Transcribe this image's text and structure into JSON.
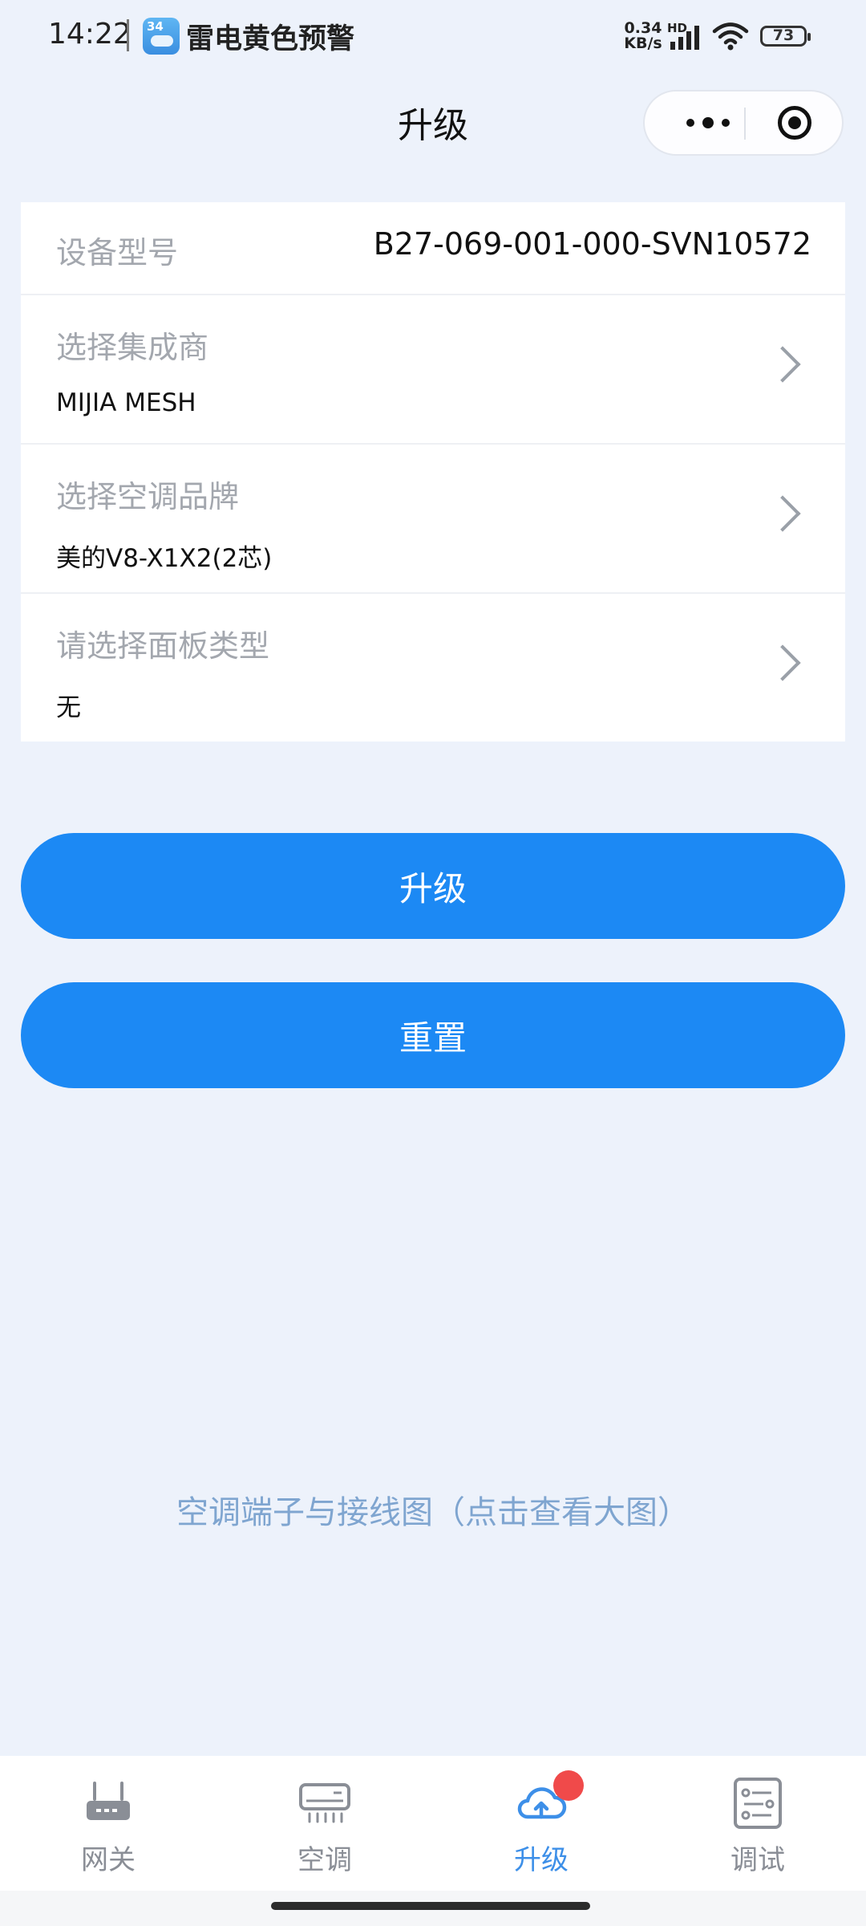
{
  "status_bar": {
    "time": "14:22",
    "alert": "雷电黄色预警",
    "weather_temp": "34",
    "net_speed_value": "0.34",
    "net_speed_unit": "KB/s",
    "network_type": "HD",
    "battery": "73"
  },
  "header": {
    "title": "升级",
    "more_icon": "more-dots-icon",
    "close_icon": "target-circle-icon"
  },
  "form": {
    "device_model_label": "设备型号",
    "device_model_value": "B27-069-001-000-SVN10572",
    "integrator_label": "选择集成商",
    "integrator_value": "MIJIA MESH",
    "ac_brand_label": "选择空调品牌",
    "ac_brand_value": "美的V8-X1X2(2芯)",
    "panel_type_label": "请选择面板类型",
    "panel_type_value": "无"
  },
  "buttons": {
    "upgrade": "升级",
    "reset": "重置"
  },
  "diagram_link": "空调端子与接线图（点击查看大图）",
  "tabbar": {
    "tabs": [
      {
        "label": "网关",
        "icon": "router-icon"
      },
      {
        "label": "空调",
        "icon": "air-conditioner-icon"
      },
      {
        "label": "升级",
        "icon": "cloud-upload-icon"
      },
      {
        "label": "调试",
        "icon": "debug-list-icon"
      }
    ],
    "active_index": 2,
    "accent_color": "#1c89f4"
  }
}
